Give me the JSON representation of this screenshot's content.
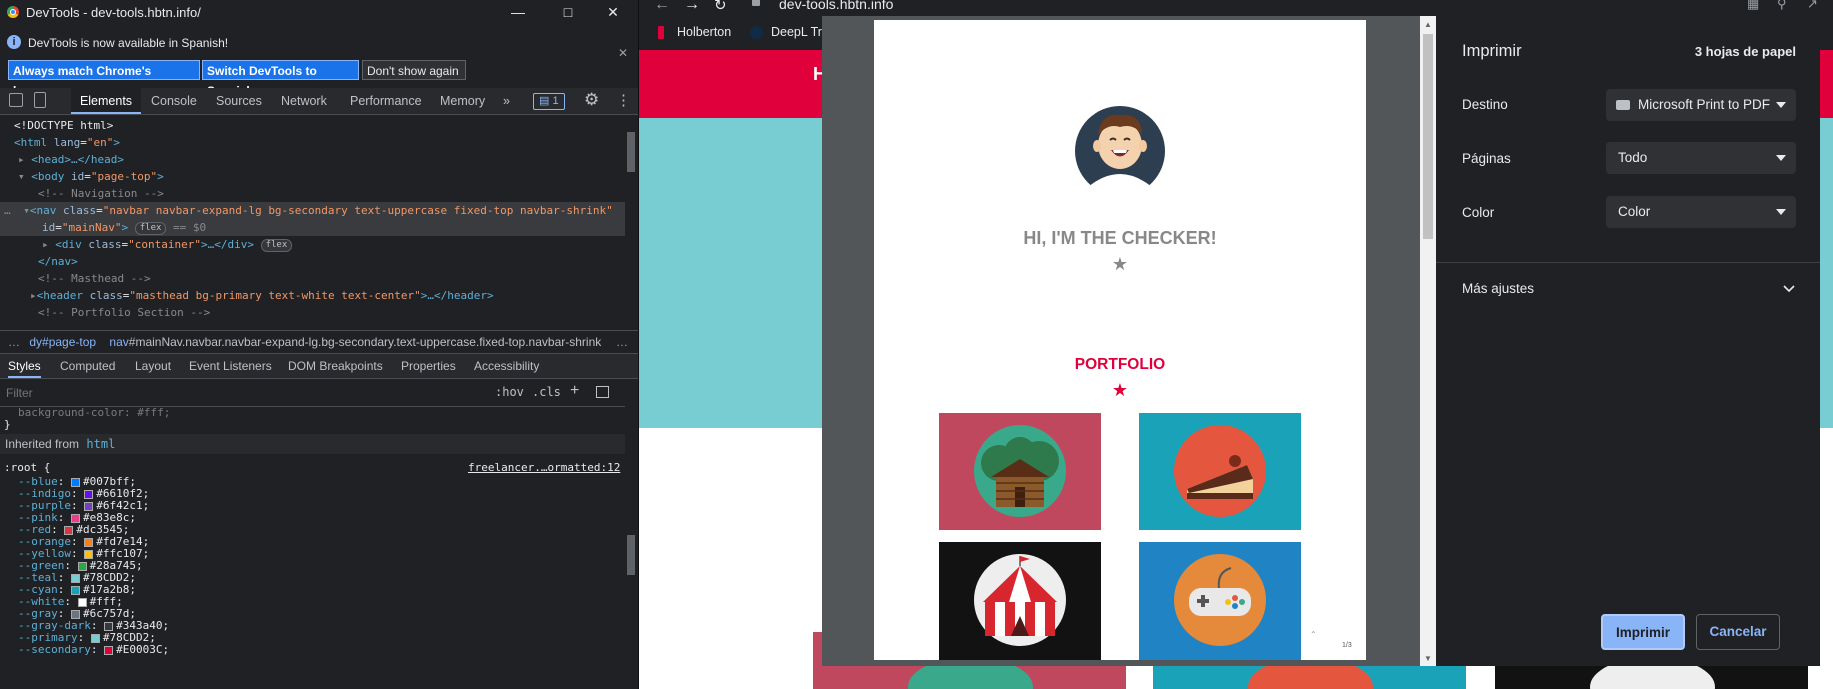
{
  "devtools": {
    "window_title": "DevTools - dev-tools.hbtn.info/",
    "banner": {
      "message": "DevTools is now available in Spanish!",
      "btn_match": "Always match Chrome's language",
      "btn_switch": "Switch DevTools to Spanish",
      "btn_dismiss": "Don't show again"
    },
    "tabs": [
      "Elements",
      "Console",
      "Sources",
      "Network",
      "Performance",
      "Memory"
    ],
    "issues_count": "1",
    "dom": {
      "l1": "<!DOCTYPE html>",
      "l2_tag": "<html",
      "l2_attr": "lang",
      "l2_val": "\"en\"",
      "l2_end": ">",
      "l3": "<head>…</head>",
      "l4_tag": "<body",
      "l4_attr": "id",
      "l4_val": "\"page-top\"",
      "l4_end": ">",
      "l5": "<!-- Navigation -->",
      "l6_tag": "<nav",
      "l6_attr": "class",
      "l6_val": "\"navbar navbar-expand-lg bg-secondary text-uppercase fixed-top navbar-shrink\"",
      "l7_attr": "id",
      "l7_val": "\"mainNav\"",
      "l7_end": ">",
      "flex": "flex",
      "l7_eq": "== $0",
      "l8_tag": "<div",
      "l8_attr": "class",
      "l8_val": "\"container\"",
      "l8_end": ">…</div>",
      "l9": "</nav>",
      "l10": "<!-- Masthead -->",
      "l11_tag": "<header",
      "l11_attr": "class",
      "l11_val": "\"masthead bg-primary text-white text-center\"",
      "l11_end": ">…</header>",
      "l12": "<!-- Portfolio Section -->"
    },
    "breadcrumb": {
      "item1": "dy#page-top",
      "item2_tag": "nav",
      "item2_rest": "#mainNav.navbar.navbar-expand-lg.bg-secondary.text-uppercase.fixed-top.navbar-shrink"
    },
    "subtabs": [
      "Styles",
      "Computed",
      "Layout",
      "Event Listeners",
      "DOM Breakpoints",
      "Properties",
      "Accessibility"
    ],
    "filter_placeholder": "Filter",
    "hov": ":hov",
    "cls": ".cls",
    "styles": {
      "bg_line": "background-color: #fff;",
      "brace_close": "}",
      "inherited_label": "Inherited from",
      "inherited_tag": "html",
      "root_selector": ":root {",
      "source_link": "freelancer.…ormatted:12",
      "vars": [
        {
          "name": "--blue",
          "value": "#007bff",
          "color": "#007bff"
        },
        {
          "name": "--indigo",
          "value": "#6610f2",
          "color": "#6610f2"
        },
        {
          "name": "--purple",
          "value": "#6f42c1",
          "color": "#6f42c1"
        },
        {
          "name": "--pink",
          "value": "#e83e8c",
          "color": "#e83e8c"
        },
        {
          "name": "--red",
          "value": "#dc3545",
          "color": "#dc3545"
        },
        {
          "name": "--orange",
          "value": "#fd7e14",
          "color": "#fd7e14"
        },
        {
          "name": "--yellow",
          "value": "#ffc107",
          "color": "#ffc107"
        },
        {
          "name": "--green",
          "value": "#28a745",
          "color": "#28a745"
        },
        {
          "name": "--teal",
          "value": "#78CDD2",
          "color": "#78CDD2"
        },
        {
          "name": "--cyan",
          "value": "#17a2b8",
          "color": "#17a2b8"
        },
        {
          "name": "--white",
          "value": "#fff",
          "color": "#ffffff"
        },
        {
          "name": "--gray",
          "value": "#6c757d",
          "color": "#6c757d"
        },
        {
          "name": "--gray-dark",
          "value": "#343a40",
          "color": "#343a40"
        },
        {
          "name": "--primary",
          "value": "#78CDD2",
          "color": "#78CDD2"
        },
        {
          "name": "--secondary",
          "value": "#E0003C",
          "color": "#E0003C"
        }
      ]
    }
  },
  "browser": {
    "url": "dev-tools.hbtn.info",
    "bookmarks": [
      "Holberton",
      "DeepL Tra"
    ],
    "colors": {
      "nav": "#e0003c",
      "masthead": "#78cdd2"
    }
  },
  "print": {
    "title": "Imprimir",
    "sheets": "3 hojas de papel",
    "destination_label": "Destino",
    "destination_value": "Microsoft Print to PDF",
    "pages_label": "Páginas",
    "pages_value": "Todo",
    "color_label": "Color",
    "color_value": "Color",
    "more_settings": "Más ajustes",
    "print_button": "Imprimir",
    "cancel_button": "Cancelar",
    "preview": {
      "heading": "HI, I'M THE CHECKER!",
      "section": "PORTFOLIO",
      "page_number": "1/3"
    }
  }
}
